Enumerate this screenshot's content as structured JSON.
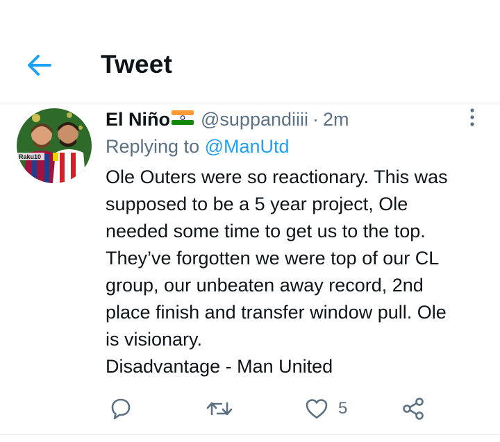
{
  "header": {
    "title": "Tweet",
    "back_icon": "arrow-left-icon"
  },
  "tweet": {
    "author_name": "El Niño",
    "author_flag": "india-flag-emoji",
    "handle": "@suppandiiii",
    "separator": "·",
    "time": "2m",
    "replying_prefix": "Replying to",
    "replying_to": "@ManUtd",
    "text_lines": [
      "Ole Outers were so reactionary. This was",
      "supposed to be a 5 year project, Ole",
      "needed some time to get us to the top.",
      "They’ve forgotten we were top of our CL",
      "group, our unbeaten away record, 2nd",
      "place finish and transfer window pull. Ole",
      "is visionary.",
      "Disadvantage - Man United"
    ],
    "avatar_text": [
      "Raku10"
    ],
    "like_count": "5"
  },
  "colors": {
    "accent": "#1da1f2",
    "muted": "#5b7083",
    "text": "#0f1419",
    "divider": "#e6ecf0"
  },
  "actions": [
    "reply-icon",
    "retweet-icon",
    "like-icon",
    "share-icon"
  ]
}
